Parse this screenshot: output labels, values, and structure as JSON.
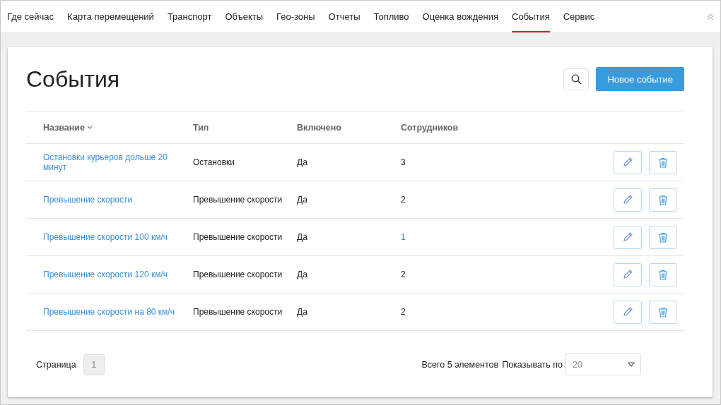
{
  "nav": {
    "items": [
      {
        "label": "Где сейчас",
        "selected": false
      },
      {
        "label": "Карта перемещений",
        "selected": false
      },
      {
        "label": "Транспорт",
        "selected": false
      },
      {
        "label": "Объекты",
        "selected": false
      },
      {
        "label": "Гео-зоны",
        "selected": false
      },
      {
        "label": "Отчеты",
        "selected": false
      },
      {
        "label": "Топливо",
        "selected": false
      },
      {
        "label": "Оценка вождения",
        "selected": false
      },
      {
        "label": "События",
        "selected": true
      },
      {
        "label": "Сервис",
        "selected": false
      }
    ]
  },
  "page": {
    "title": "События",
    "new_button": "Новое событие"
  },
  "table": {
    "columns": [
      {
        "label": "Название",
        "sorted": true
      },
      {
        "label": "Тип",
        "sorted": false
      },
      {
        "label": "Включено",
        "sorted": false
      },
      {
        "label": "Сотрудников",
        "sorted": false
      }
    ],
    "rows": [
      {
        "name": "Остановки курьеров дольше 20 минут",
        "type": "Остановки",
        "enabled": "Да",
        "employees": "3",
        "employees_link": false
      },
      {
        "name": "Превышение скорости",
        "type": "Превышение скорости",
        "enabled": "Да",
        "employees": "2",
        "employees_link": false
      },
      {
        "name": "Превышение скорости 100 км/ч",
        "type": "Превышение скорости",
        "enabled": "Да",
        "employees": "1",
        "employees_link": true
      },
      {
        "name": "Превышение скорости 120 км/ч",
        "type": "Превышение скорости",
        "enabled": "Да",
        "employees": "2",
        "employees_link": false
      },
      {
        "name": "Превышение скорости на 80 км/ч",
        "type": "Превышение скорости",
        "enabled": "Да",
        "employees": "2",
        "employees_link": false
      }
    ]
  },
  "footer": {
    "page_label": "Страница",
    "page": "1",
    "total": "Всего 5 элементов",
    "per_page_label": "Показывать по",
    "per_page": "20"
  }
}
